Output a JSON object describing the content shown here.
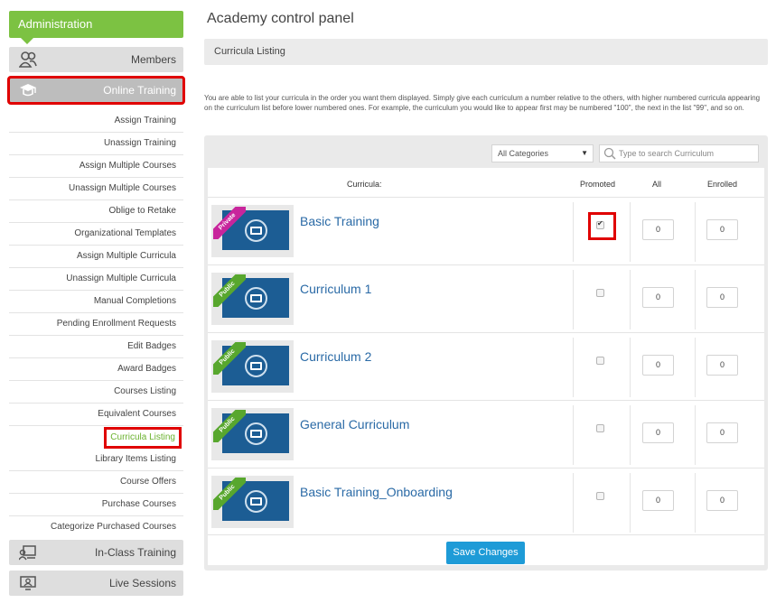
{
  "sidebar": {
    "header": "Administration",
    "sections": {
      "members": {
        "label": "Members",
        "icon": "members-icon"
      },
      "online_training": {
        "label": "Online Training",
        "icon": "graduation-cap-icon"
      },
      "in_class": {
        "label": "In-Class Training",
        "icon": "classroom-icon"
      },
      "live_sessions": {
        "label": "Live Sessions",
        "icon": "live-session-icon"
      }
    },
    "items": [
      "Assign Training",
      "Unassign Training",
      "Assign Multiple Courses",
      "Unassign Multiple Courses",
      "Oblige to Retake",
      "Organizational Templates",
      "Assign Multiple Curricula",
      "Unassign Multiple Curricula",
      "Manual Completions",
      "Pending Enrollment Requests",
      "Edit Badges",
      "Award Badges",
      "Courses Listing",
      "Equivalent Courses",
      "Curricula Listing",
      "Library Items Listing",
      "Course Offers",
      "Purchase Courses",
      "Categorize Purchased Courses"
    ]
  },
  "main": {
    "title": "Academy control panel",
    "listing_title": "Curricula Listing",
    "instructions": "You are able to list your curricula in the order you want them displayed. Simply give each curriculum a number relative to the others, with higher numbered curricula appearing on the curriculum list before lower numbered ones. For example, the curriculum you would like to appear first may be numbered \"100\", the next in the list \"99\", and so on.",
    "category_select": "All Categories",
    "search_placeholder": "Type to search Curriculum",
    "columns": {
      "curricula": "Curricula:",
      "promoted": "Promoted",
      "all": "All",
      "enrolled": "Enrolled"
    },
    "rows": [
      {
        "name": "Basic Training",
        "ribbon": "Private",
        "promoted": true,
        "all": "0",
        "enrolled": "0"
      },
      {
        "name": "Curriculum 1",
        "ribbon": "Public",
        "promoted": false,
        "all": "0",
        "enrolled": "0"
      },
      {
        "name": "Curriculum 2",
        "ribbon": "Public",
        "promoted": false,
        "all": "0",
        "enrolled": "0"
      },
      {
        "name": "General Curriculum",
        "ribbon": "Public",
        "promoted": false,
        "all": "0",
        "enrolled": "0"
      },
      {
        "name": "Basic Training_Onboarding",
        "ribbon": "Public",
        "promoted": false,
        "all": "0",
        "enrolled": "0"
      }
    ],
    "save_label": "Save Changes"
  },
  "colors": {
    "accent_green": "#7cc242",
    "link_blue": "#2a6aa6",
    "button_blue": "#1e9bd7",
    "highlight_red": "#e00000",
    "private_ribbon": "#c8259c",
    "public_ribbon": "#58a72e"
  }
}
